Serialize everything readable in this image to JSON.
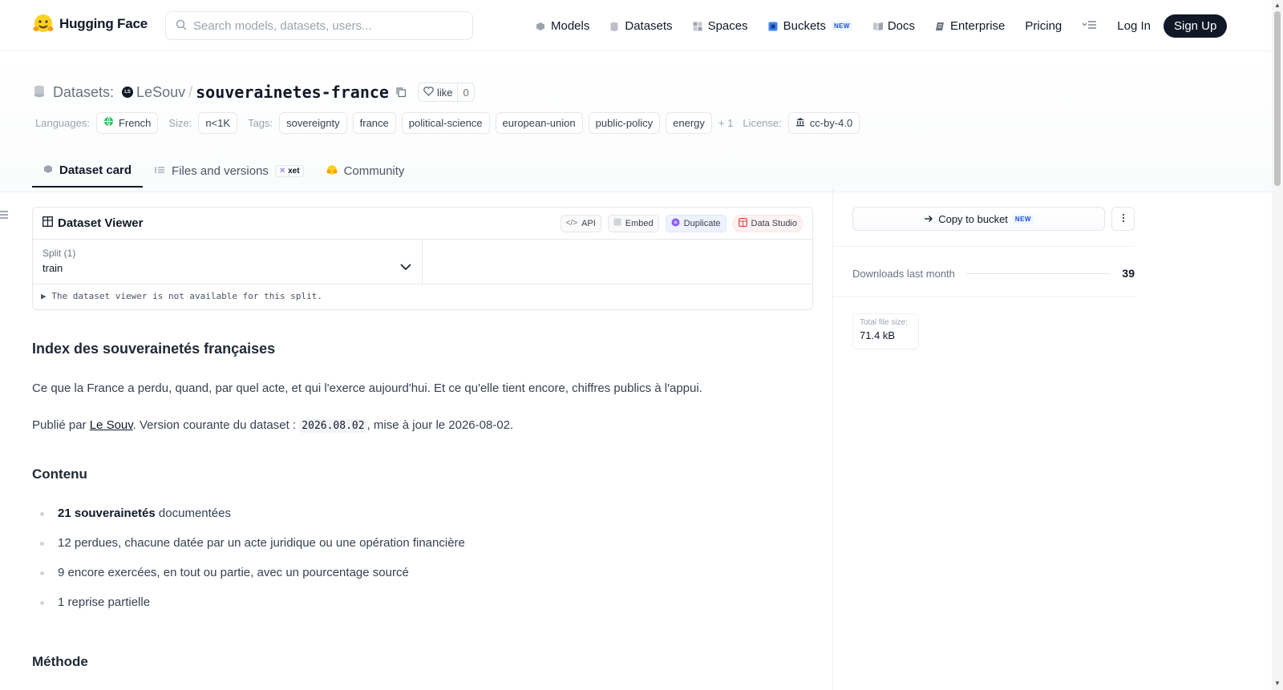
{
  "nav": {
    "brand": "Hugging Face",
    "search_placeholder": "Search models, datasets, users...",
    "links": [
      {
        "label": "Models",
        "icon": "cube-icon"
      },
      {
        "label": "Datasets",
        "icon": "database-icon"
      },
      {
        "label": "Spaces",
        "icon": "grid-icon"
      },
      {
        "label": "Buckets",
        "icon": "bucket-icon",
        "badge": "NEW"
      },
      {
        "label": "Docs",
        "icon": "book-icon"
      },
      {
        "label": "Enterprise",
        "icon": "enterprise-icon"
      },
      {
        "label": "Pricing"
      }
    ],
    "login": "Log In",
    "signup": "Sign Up"
  },
  "header": {
    "type_label": "Datasets:",
    "org_initials": "LS",
    "org": "LeSouv",
    "separator": "/",
    "repo": "souverainetes-france",
    "like_label": "like",
    "like_count": "0",
    "languages_label": "Languages:",
    "language": "French",
    "size_label": "Size:",
    "size": "n<1K",
    "tags_label": "Tags:",
    "tags": [
      "sovereignty",
      "france",
      "political-science",
      "european-union",
      "public-policy",
      "energy"
    ],
    "more_tags": "+ 1",
    "license_label": "License:",
    "license": "cc-by-4.0"
  },
  "tabs": [
    {
      "label": "Dataset card",
      "icon": "cube-icon",
      "active": true
    },
    {
      "label": "Files and versions",
      "icon": "files-icon",
      "badge": "xet"
    },
    {
      "label": "Community",
      "icon": "community-icon"
    }
  ],
  "viewer": {
    "title": "Dataset Viewer",
    "actions": [
      "API",
      "Embed",
      "Duplicate",
      "Data Studio"
    ],
    "split_label": "Split (1)",
    "split_value": "train",
    "note": "The dataset viewer is not available for this split."
  },
  "content": {
    "h1": "Index des souverainetés françaises",
    "intro": "Ce que la France a perdu, quand, par quel acte, et qui l'exerce aujourd'hui. Et ce qu'elle tient encore, chiffres publics à l'appui.",
    "pub_prefix": "Publié par ",
    "pub_link": "Le Souv",
    "pub_mid": ". Version courante du dataset : ",
    "version": "2026.08.02",
    "pub_suffix": ", mise à jour le 2026-08-02.",
    "h2_contenu": "Contenu",
    "bullet1_bold": "21 souverainetés",
    "bullet1_rest": " documentées",
    "bullet2": "12 perdues, chacune datée par un acte juridique ou une opération financière",
    "bullet3": "9 encore exercées, en tout ou partie, avec un pourcentage sourcé",
    "bullet4": "1 reprise partielle",
    "h2_methode": "Méthode"
  },
  "sidebar": {
    "copy_bucket": "Copy to bucket",
    "copy_badge": "NEW",
    "downloads_label": "Downloads last month",
    "downloads": "39",
    "filesize_label": "Total file size:",
    "filesize": "71.4 kB"
  }
}
